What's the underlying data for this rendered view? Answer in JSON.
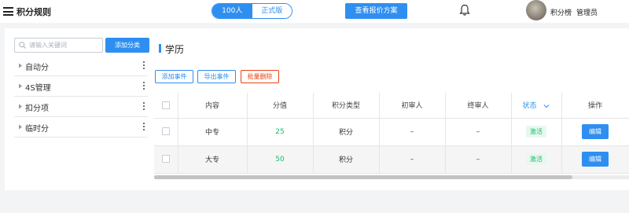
{
  "app": {
    "title": "积分规则"
  },
  "header": {
    "toggle": {
      "active": "100人",
      "inactive": "正式版"
    },
    "quote_button": "查看报价方案",
    "user": {
      "name": "积分榜",
      "role": "管理员"
    },
    "icons": [
      "menu-icon",
      "bell-icon",
      "avatar"
    ]
  },
  "sidebar": {
    "search_placeholder": "请输入关键词",
    "add_button": "添加分类",
    "items": [
      {
        "label": "自动分"
      },
      {
        "label": "4S管理"
      },
      {
        "label": "扣分项"
      },
      {
        "label": "临时分"
      }
    ]
  },
  "content": {
    "section_title": "学历",
    "actions": {
      "add": "添加事件",
      "export": "导出事件",
      "batch_delete": "批量删除"
    },
    "table": {
      "headers": {
        "content": "内容",
        "score": "分值",
        "type": "积分类型",
        "first_reviewer": "初审人",
        "final_reviewer": "终审人",
        "status": "状态",
        "actions": "操作"
      },
      "rows": [
        {
          "content": "中专",
          "score": "25",
          "type": "积分",
          "first_reviewer": "–",
          "final_reviewer": "–",
          "status": "激活",
          "action": "编辑"
        },
        {
          "content": "大专",
          "score": "50",
          "type": "积分",
          "first_reviewer": "–",
          "final_reviewer": "–",
          "status": "激活",
          "action": "编辑"
        }
      ]
    }
  },
  "colors": {
    "primary": "#2f8ff0",
    "danger": "#ed4014",
    "success": "#19be6b"
  }
}
